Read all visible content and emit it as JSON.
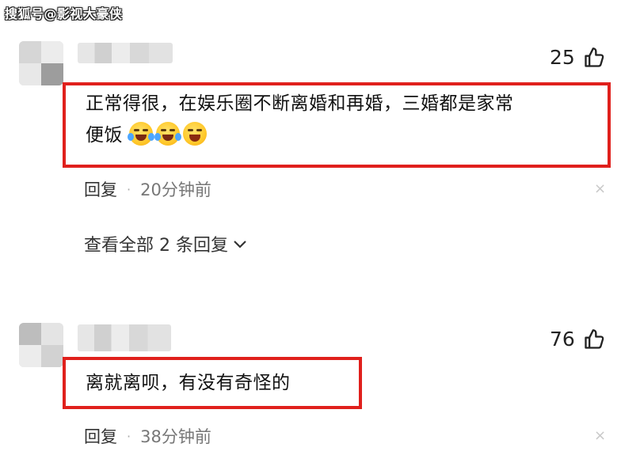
{
  "watermark": "搜狐号@影视大豪侠",
  "comments": [
    {
      "likes": "25",
      "text_line1": "正常得很，在娱乐圈不断离婚和再婚，三婚都是家常",
      "text_line2": "便饭",
      "emojis": [
        "laugh-cry-emoji",
        "laugh-cry-emoji",
        "grin-emoji"
      ],
      "reply_label": "回复",
      "separator": "·",
      "time": "20分钟前",
      "close": "×",
      "view_replies": "查看全部 2 条回复"
    },
    {
      "likes": "76",
      "text_line1": "离就离呗，有没有奇怪的",
      "reply_label": "回复",
      "separator": "·",
      "time": "38分钟前",
      "close": "×"
    }
  ],
  "colors": {
    "highlight_box": "#e0201c"
  },
  "icons": [
    "thumbs-up-icon",
    "close-icon",
    "chevron-down-icon"
  ]
}
